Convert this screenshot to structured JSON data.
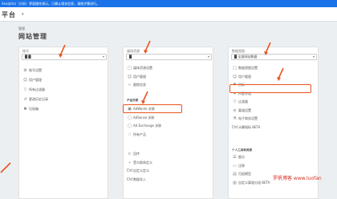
{
  "notice": "Analytics（分析）界面操作演示。已确认相关信息，请按步骤进行。",
  "app_title": "平台",
  "header": {
    "label": "管理",
    "name": "网站管理"
  },
  "columns": {
    "account": {
      "title": "账号",
      "selector": "█ █",
      "items": [
        {
          "icon": "settings-icon",
          "glyph": "⚙",
          "label": "账号设置"
        },
        {
          "icon": "users-icon",
          "glyph": "☺",
          "label": "用户管理"
        },
        {
          "icon": "filter-icon",
          "glyph": "▽",
          "label": "所有过滤器"
        },
        {
          "icon": "history-icon",
          "glyph": "↺",
          "label": "更改历史记录"
        },
        {
          "icon": "trash-icon",
          "glyph": "✖",
          "label": "垃圾箱"
        }
      ]
    },
    "property": {
      "title": "媒体资源",
      "selector": "█",
      "items": [
        {
          "icon": "property-settings-icon",
          "glyph": "□",
          "label": "媒体资源设置"
        },
        {
          "icon": "users-icon",
          "glyph": "☺",
          "label": "用户管理"
        },
        {
          "icon": "tracking-icon",
          "glyph": "‹›",
          "label": "跟踪信息"
        }
      ],
      "section_label": "产品关联",
      "product_links": [
        {
          "icon": "adwords-icon",
          "glyph": "▣",
          "label": "AdWords 关联",
          "highlighted": true
        },
        {
          "icon": "adsense-icon",
          "glyph": "□",
          "label": "AdSense 关联"
        },
        {
          "icon": "adexchange-icon",
          "glyph": "□",
          "label": "Ad Exchange 关联"
        },
        {
          "icon": "all-products-icon",
          "glyph": "∷",
          "label": "所有产品"
        }
      ],
      "more_items": [
        {
          "icon": "postbacks-icon",
          "glyph": "⊂",
          "label": "回传"
        },
        {
          "icon": "audience-icon",
          "glyph": "⑂",
          "label": "受众群体定义"
        },
        {
          "icon": "custom-definitions-icon",
          "glyph": "Dd",
          "label": "自定义定义"
        },
        {
          "icon": "data-import-icon",
          "glyph": "Dd",
          "label": "数据导入"
        }
      ]
    },
    "view": {
      "title": "数据视图",
      "selector": "█ 全部网站数据",
      "items": [
        {
          "icon": "view-settings-icon",
          "glyph": "□",
          "label": "数据视图设置"
        },
        {
          "icon": "users-icon",
          "glyph": "☺",
          "label": "用户管理"
        },
        {
          "icon": "goals-icon",
          "glyph": "⚑",
          "label": "目标",
          "highlighted": true
        },
        {
          "icon": "content-grouping-icon",
          "glyph": "✦",
          "label": "内容分组"
        },
        {
          "icon": "filter-icon",
          "glyph": "▽",
          "label": "过滤器"
        },
        {
          "icon": "channel-settings-icon",
          "glyph": "≡",
          "label": "渠道设置"
        },
        {
          "icon": "ecommerce-icon",
          "glyph": "⚗",
          "label": "电子商务设置"
        },
        {
          "icon": "calculated-metrics-icon",
          "glyph": "Dd",
          "label": "计算指标 BETA"
        }
      ],
      "section_label": "个人工具和资源",
      "personal_items": [
        {
          "icon": "segments-icon",
          "glyph": "☰",
          "label": "细分"
        },
        {
          "icon": "annotations-icon",
          "glyph": "▭",
          "label": "注释"
        },
        {
          "icon": "attribution-icon",
          "glyph": "▤",
          "label": "归因模型"
        },
        {
          "icon": "custom-channel-icon",
          "glyph": "▥",
          "label": "自定义渠道分组 BETA"
        }
      ]
    }
  },
  "watermark": "罗帆博客 www.luofan",
  "colors": {
    "accent": "#e8541e",
    "topbar": "#1a73e8",
    "watermark": "#d93025"
  }
}
